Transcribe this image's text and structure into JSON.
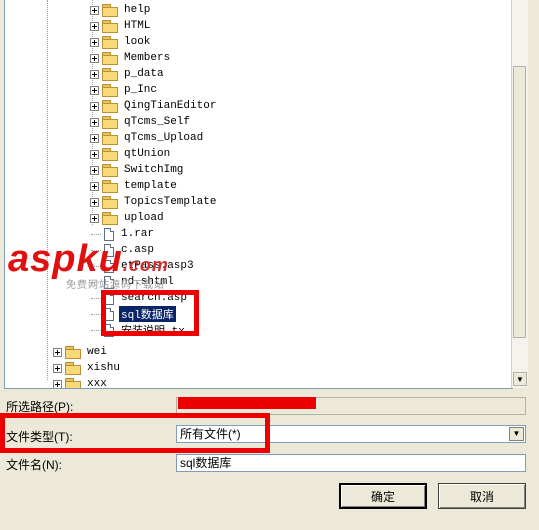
{
  "tree": {
    "subfolders": [
      {
        "label": "help"
      },
      {
        "label": "HTML"
      },
      {
        "label": "look"
      },
      {
        "label": "Members"
      },
      {
        "label": "p_data"
      },
      {
        "label": "p_Inc"
      },
      {
        "label": "QingTianEditor"
      },
      {
        "label": "qTcms_Self"
      },
      {
        "label": "qTcms_Upload"
      },
      {
        "label": "qtUnion"
      },
      {
        "label": "SwitchImg"
      },
      {
        "label": "template"
      },
      {
        "label": "TopicsTemplate"
      },
      {
        "label": "upload"
      }
    ],
    "files": [
      {
        "label": "1.rar"
      },
      {
        "label": "c.asp"
      },
      {
        "label": "etPass.asp3"
      },
      {
        "label": "nd.shtml"
      },
      {
        "label": "search.asp"
      },
      {
        "label": "sql数据库",
        "selected": true
      },
      {
        "label": "安装说明.tx"
      }
    ],
    "root_folders": [
      {
        "label": "wei"
      },
      {
        "label": "xishu"
      },
      {
        "label": "xxx"
      }
    ]
  },
  "form": {
    "path_label": "所选路径(P):",
    "path_value": "",
    "filetype_label": "文件类型(T):",
    "filetype_value": "所有文件(*)",
    "filename_label": "文件名(N):",
    "filename_value": "sql数据库"
  },
  "buttons": {
    "ok": "确定",
    "cancel": "取消"
  },
  "watermark": {
    "main": "aspku",
    "domain": ".com",
    "sub": "免费网站源码下载站"
  },
  "colors": {
    "highlight": "#0a246a",
    "annotation_red": "#ee0000",
    "dialog_bg": "#ece9d8"
  }
}
